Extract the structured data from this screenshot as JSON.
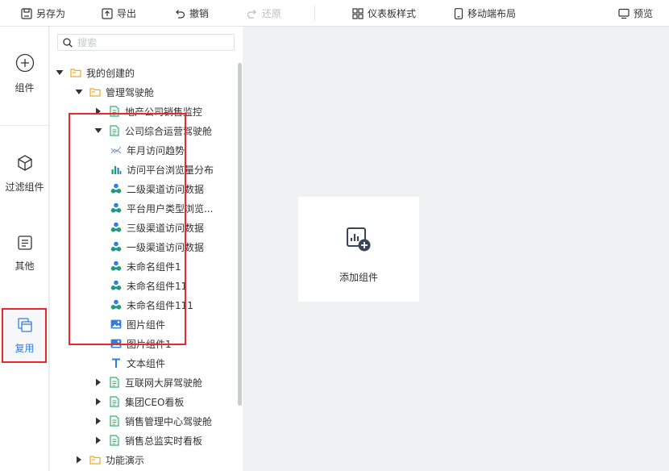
{
  "toolbar": {
    "save_as": "另存为",
    "export": "导出",
    "undo": "撤销",
    "redo": "还原",
    "dashboard_style": "仪表板样式",
    "mobile_layout": "移动端布局",
    "preview": "预览"
  },
  "leftnav": {
    "components": "组件",
    "filter_components": "过滤组件",
    "other": "其他",
    "reuse": "复用"
  },
  "search": {
    "placeholder": "搜索"
  },
  "tree": {
    "my_created": "我的创建的",
    "cockpit": "管理驾驶舱",
    "real_estate": "地产公司销售监控",
    "company_ops": "公司综合运营驾驶舱",
    "children": [
      {
        "label": "年月访问趋势",
        "icon": "line-chart-icon"
      },
      {
        "label": "访问平台浏览量分布",
        "icon": "bar-chart-icon"
      },
      {
        "label": "二级渠道访问数据",
        "icon": "cluster-icon"
      },
      {
        "label": "平台用户类型浏览...",
        "icon": "cluster-icon"
      },
      {
        "label": "三级渠道访问数据",
        "icon": "cluster-icon"
      },
      {
        "label": "一级渠道访问数据",
        "icon": "cluster-icon"
      },
      {
        "label": "未命名组件1",
        "icon": "cluster-icon"
      },
      {
        "label": "未命名组件11",
        "icon": "cluster-icon"
      },
      {
        "label": "未命名组件111",
        "icon": "cluster-icon"
      },
      {
        "label": "图片组件",
        "icon": "image-icon"
      },
      {
        "label": "图片组件1",
        "icon": "image-icon"
      },
      {
        "label": "文本组件",
        "icon": "text-icon"
      }
    ],
    "internet": "互联网大屏驾驶舱",
    "group_ceo": "集团CEO看板",
    "sales_mgmt": "销售管理中心驾驶舱",
    "sales_monitor": "销售总监实时看板",
    "demo": "功能演示"
  },
  "canvas": {
    "add_component": "添加组件"
  },
  "colors": {
    "accent": "#2f7de1",
    "highlight": "#e8282b",
    "folder": "#f5a623",
    "doc": "#2db36a",
    "cluster": "#1f9c6a"
  }
}
